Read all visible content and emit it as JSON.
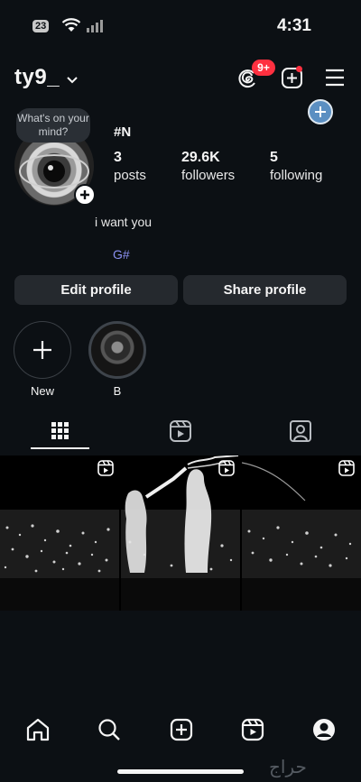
{
  "status_bar": {
    "time": "4:31",
    "signal_box": "23"
  },
  "header": {
    "username": "ty9_",
    "notifications_badge": "9+"
  },
  "profile": {
    "note": "What's on your mind?",
    "display_name": "#N",
    "stats": [
      {
        "number": "3",
        "label": "posts"
      },
      {
        "number": "29.6K",
        "label": "followers"
      },
      {
        "number": "5",
        "label": "following"
      }
    ],
    "bio": "i want you",
    "link": "G#"
  },
  "actions": {
    "edit_profile": "Edit profile",
    "share_profile": "Share profile"
  },
  "highlights": [
    {
      "label": "New"
    },
    {
      "label": "B"
    }
  ],
  "tabs": [
    "grid-icon",
    "reels-icon",
    "tagged-icon"
  ],
  "bottom_nav": [
    "home-icon",
    "search-icon",
    "create-icon",
    "reels-icon",
    "profile-icon"
  ],
  "watermark": "حراج",
  "colors": {
    "background": "#0c1014",
    "button": "#25292e",
    "badge": "#ff3040",
    "link": "#8a90f0"
  }
}
